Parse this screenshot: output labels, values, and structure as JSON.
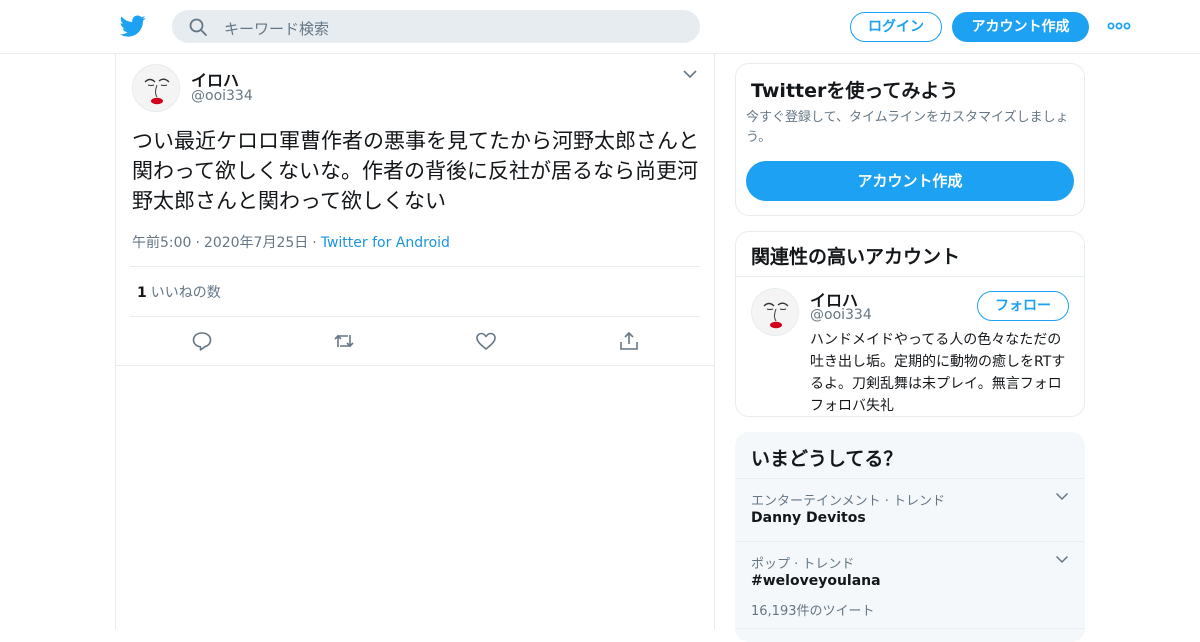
{
  "colors": {
    "brand": "#1da1f2",
    "link": "#1b95e0",
    "muted": "#657786"
  },
  "header": {
    "logo_icon": "twitter-bird-icon",
    "search_placeholder": "キーワード検索",
    "login_label": "ログイン",
    "signup_label": "アカウント作成",
    "more_icon": "more-dots-icon"
  },
  "tweet": {
    "author_name": "イロハ",
    "author_handle": "@ooi334",
    "text": "つい最近ケロロ軍曹作者の悪事を見てたから河野太郎さんと関わって欲しくないな。作者の背後に反社が居るなら尚更河野太郎さんと関わって欲しくない",
    "time": "午前5:00",
    "date": "2020年7月25日",
    "source": "Twitter for Android",
    "separator": "·",
    "like_count": "1",
    "like_label": "いいねの数",
    "actions": [
      "reply-icon",
      "retweet-icon",
      "like-icon",
      "share-icon"
    ]
  },
  "sidebar": {
    "signup_card": {
      "title": "Twitterを使ってみよう",
      "description": "今すぐ登録して、タイムラインをカスタマイズしましょう。",
      "button_label": "アカウント作成"
    },
    "related": {
      "title": "関連性の高いアカウント",
      "account": {
        "name": "イロハ",
        "handle": "@ooi334",
        "follow_label": "フォロー",
        "bio": "ハンドメイドやってる人の色々なただの吐き出し垢。定期的に動物の癒しをRTするよ。刀剣乱舞は未プレイ。無言フォロフォロバ失礼"
      }
    },
    "trends": {
      "title": "いまどうしてる？",
      "items": [
        {
          "category": "エンターテインメント · トレンド",
          "name": "Danny Devitos",
          "count": ""
        },
        {
          "category": "ポップ · トレンド",
          "name": "#weloveyoulana",
          "count": "16,193件のツイート"
        }
      ]
    }
  }
}
